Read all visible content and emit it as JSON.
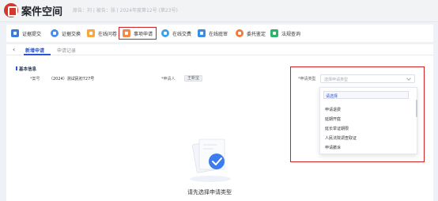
{
  "header": {
    "title": "案件空间",
    "case_info": "原告：刘 | 被告：张 | 2024年度第12号 (第23号)"
  },
  "toolbar": {
    "items": [
      {
        "label": "证据提交",
        "icon": "file-upload-icon",
        "color": "#3a7bd5"
      },
      {
        "label": "证据交换",
        "icon": "exchange-icon",
        "color": "#4b8be8"
      },
      {
        "label": "在线问卷",
        "icon": "questionnaire-icon",
        "color": "#f5a742"
      },
      {
        "label": "事项申请",
        "icon": "application-icon",
        "color": "#f08a4b"
      },
      {
        "label": "在线交费",
        "icon": "payment-icon",
        "color": "#3aa0e8"
      },
      {
        "label": "在线庭审",
        "icon": "video-trial-icon",
        "color": "#3a8ee6"
      },
      {
        "label": "委托鉴定",
        "icon": "appraisal-icon",
        "color": "#f07a3a"
      },
      {
        "label": "法规查询",
        "icon": "law-search-icon",
        "color": "#2fb36b"
      }
    ]
  },
  "tabs": [
    {
      "label": "新增申请"
    },
    {
      "label": "申请记录"
    }
  ],
  "form": {
    "section_title": "基本信息",
    "case_no_label": "*案号",
    "case_no_value": "（2024）测试民初727号",
    "applicant_label": "*申请人",
    "applicant_value": "王新宝",
    "type_label": "*申请类型",
    "type_placeholder": "选择申请类型"
  },
  "dropdown": {
    "options": [
      "请选择",
      "申请退费",
      "延期开庭",
      "延长举证期限",
      "人民法院调查取证",
      "申请撤诉"
    ]
  },
  "empty_state": {
    "text": "请先选择申请类型"
  }
}
